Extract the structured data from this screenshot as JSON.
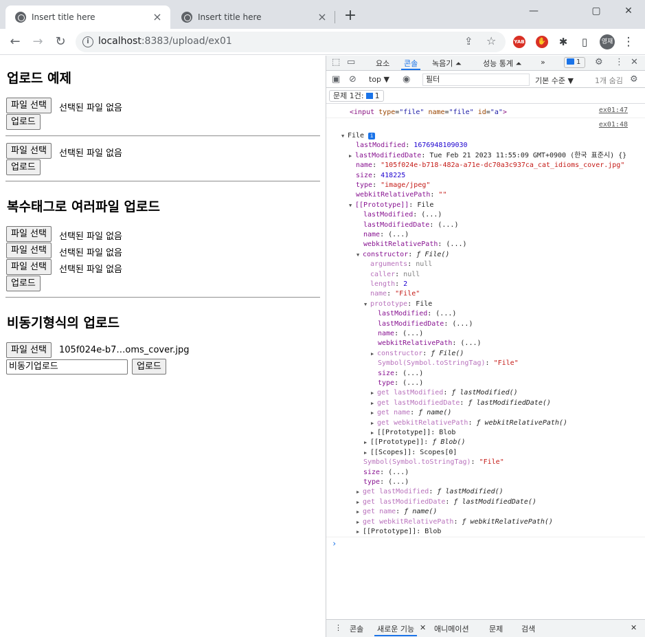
{
  "browser": {
    "tabs": [
      {
        "title": "Insert title here",
        "active": true
      },
      {
        "title": "Insert title here",
        "active": false
      }
    ],
    "new_tab": "+",
    "window": {
      "minimize": "—",
      "restore": "▢",
      "close": "✕"
    },
    "nav": {
      "back": "←",
      "forward": "→",
      "reload": "↻"
    },
    "url_host": "localhost",
    "url_rest": ":8383/upload/ex01",
    "extensions": [
      {
        "label": "YAB",
        "color": "#d93025"
      },
      {
        "label": "✋",
        "color": "#d93025"
      }
    ],
    "puzzle": "✱",
    "sidepanel": "▯",
    "profile": "영재",
    "menu": "⋮"
  },
  "page": {
    "sections": [
      {
        "heading": "업로드 예제"
      },
      {
        "heading": "복수태그로 여러파일 업로드"
      },
      {
        "heading": "비동기형식의 업로드"
      }
    ],
    "file_button": "파일 선택",
    "no_file": "선택된 파일 없음",
    "upload_button": "업로드",
    "async_file_name": "105f024e-b7…oms_cover.jpg",
    "async_text_value": "비동기업로드",
    "async_upload_button": "업로드"
  },
  "devtools": {
    "tabs": [
      "요소",
      "콘솔",
      "녹음기 ⏶",
      "성능 통계 ⏶",
      "»"
    ],
    "issue_count": "1",
    "context": "top ▼",
    "filter_placeholder": "필터",
    "levels": "기본 수준 ▼",
    "hidden": "1개 숨김",
    "issues_label": "문제 1건:",
    "issues_count": "1",
    "sources": [
      "ex01:47",
      "ex01:48"
    ],
    "drawer_tabs": [
      "콘솔",
      "새로운 기능",
      "애니메이션",
      "문제",
      "검색"
    ]
  }
}
